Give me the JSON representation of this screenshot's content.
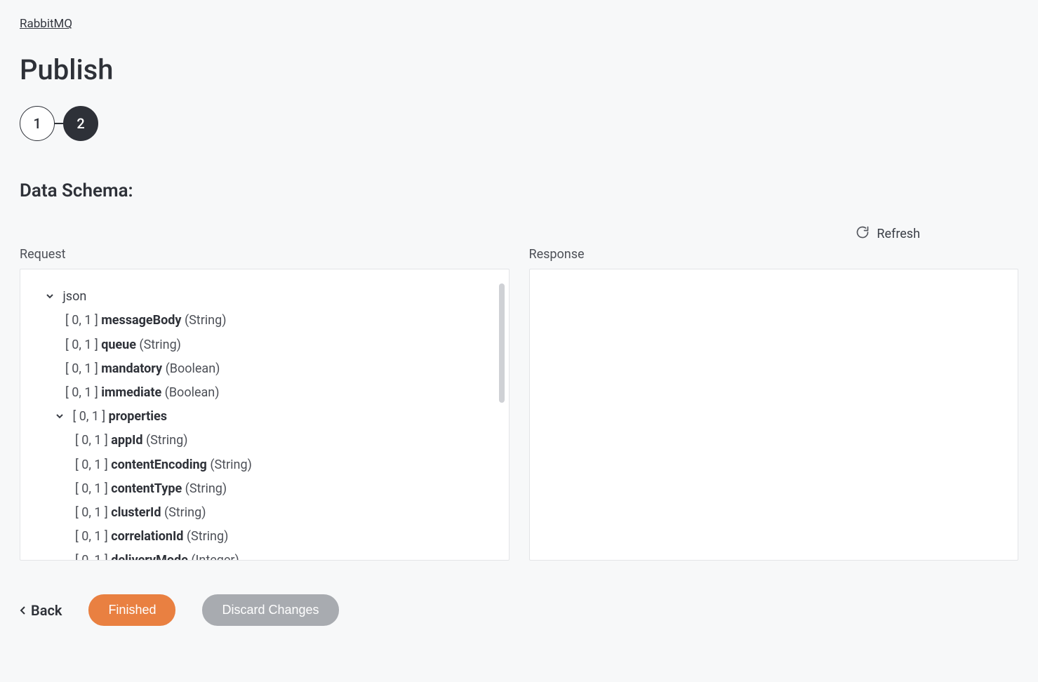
{
  "breadcrumb": "RabbitMQ",
  "page_title": "Publish",
  "stepper": {
    "step1": "1",
    "step2": "2"
  },
  "section_title": "Data Schema:",
  "refresh_label": "Refresh",
  "panel_labels": {
    "request": "Request",
    "response": "Response"
  },
  "tree": {
    "root": "json",
    "card_prefix": "[ 0, 1 ]",
    "items": [
      {
        "name": "messageBody",
        "type": "(String)"
      },
      {
        "name": "queue",
        "type": "(String)"
      },
      {
        "name": "mandatory",
        "type": "(Boolean)"
      },
      {
        "name": "immediate",
        "type": "(Boolean)"
      }
    ],
    "group": {
      "name": "properties",
      "items": [
        {
          "name": "appId",
          "type": "(String)"
        },
        {
          "name": "contentEncoding",
          "type": "(String)"
        },
        {
          "name": "contentType",
          "type": "(String)"
        },
        {
          "name": "clusterId",
          "type": "(String)"
        },
        {
          "name": "correlationId",
          "type": "(String)"
        },
        {
          "name": "deliveryMode",
          "type": "(Integer)"
        }
      ]
    }
  },
  "footer": {
    "back": "Back",
    "finished": "Finished",
    "discard": "Discard Changes"
  }
}
